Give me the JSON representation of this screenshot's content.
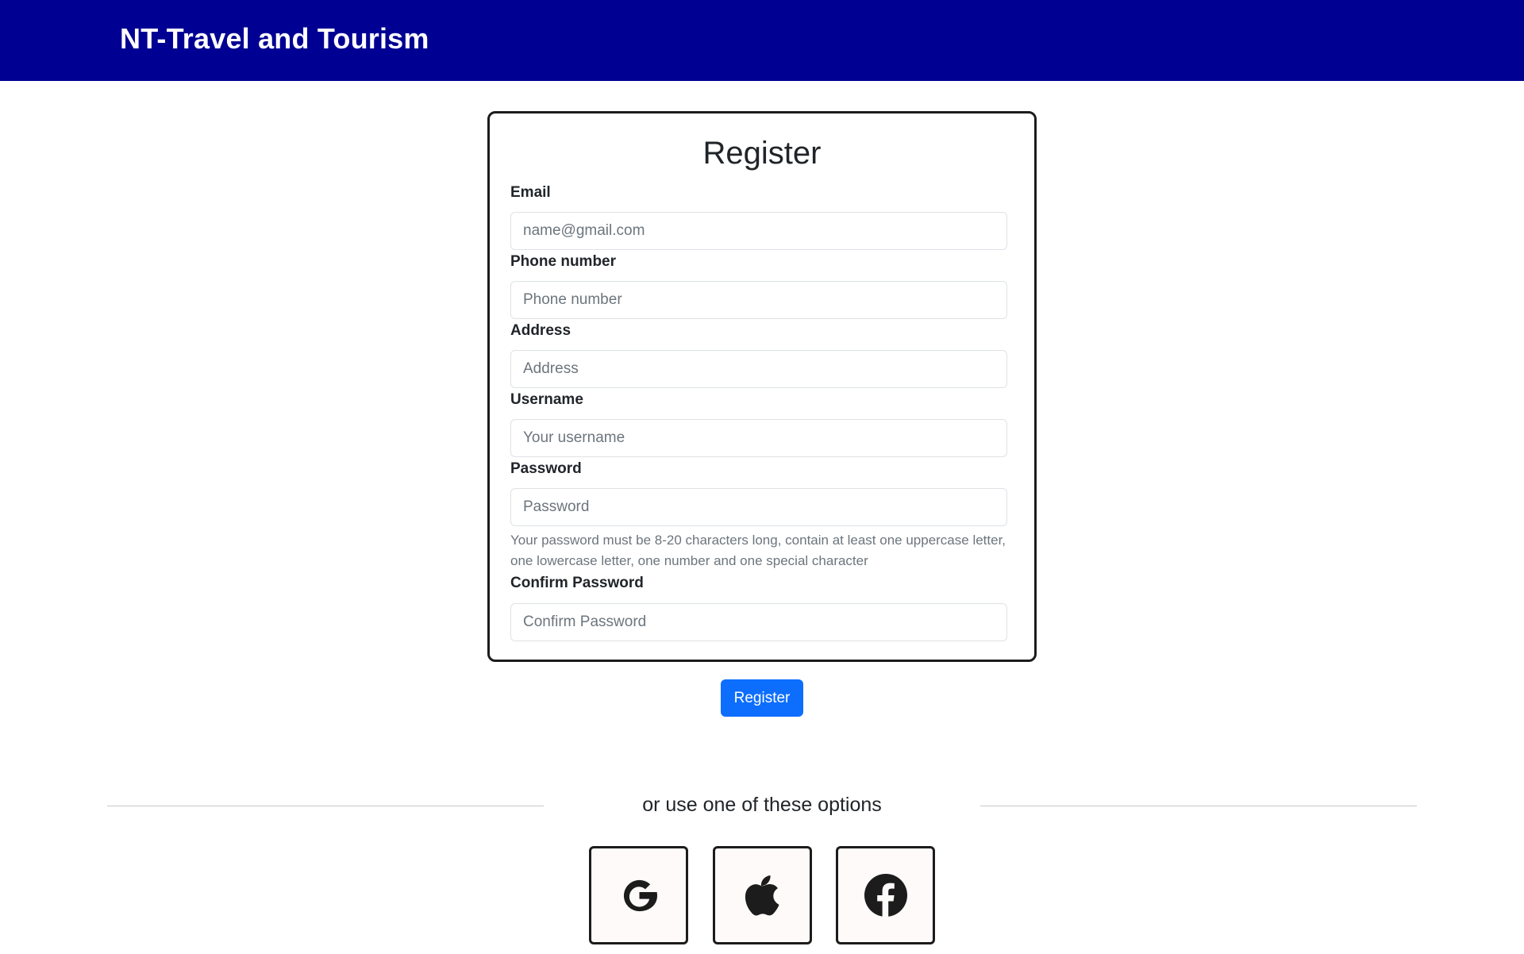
{
  "navbar": {
    "brand": "NT-Travel and Tourism",
    "background": "#000093"
  },
  "form": {
    "title": "Register",
    "fields": [
      {
        "label": "Email",
        "placeholder": "name@gmail.com",
        "value": ""
      },
      {
        "label": "Phone number",
        "placeholder": "Phone number",
        "value": ""
      },
      {
        "label": "Address",
        "placeholder": "Address",
        "value": ""
      },
      {
        "label": "Username",
        "placeholder": "Your username",
        "value": ""
      },
      {
        "label": "Password",
        "placeholder": "Password",
        "value": ""
      },
      {
        "label": "Confirm Password",
        "placeholder": "Confirm Password",
        "value": ""
      }
    ],
    "password_hint": "Your password must be 8-20 characters long, contain at least one uppercase letter, one lowercase letter, one number and one special character",
    "submit_label": "Register",
    "submit_color": "#0d6efd"
  },
  "alternatives": {
    "text": "or use one of these options",
    "options": [
      {
        "icon": "google-icon"
      },
      {
        "icon": "apple-icon"
      },
      {
        "icon": "facebook-icon"
      }
    ]
  }
}
